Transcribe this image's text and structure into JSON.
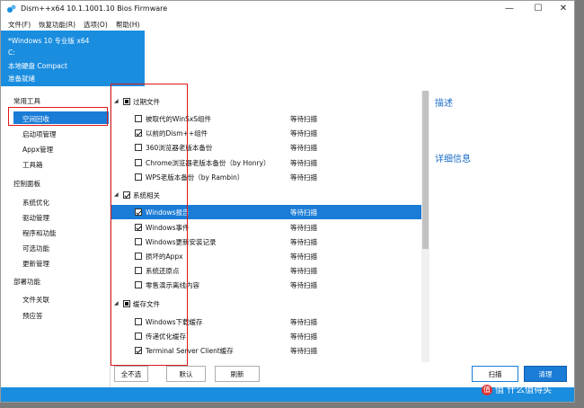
{
  "window": {
    "title": "Dism++x64 10.1.1001.10 Bios Firmware",
    "controls": {
      "minimize": "—",
      "maximize": "☐",
      "close": "✕"
    }
  },
  "menu": [
    "文件(F)",
    "恢复功能(R)",
    "选项(O)",
    "帮助(H)"
  ],
  "header": {
    "os": "*Windows 10 专业版 x64",
    "drive": "C:",
    "disk": "本地硬盘 Compact",
    "status": "准备就绪"
  },
  "sidebar": {
    "group_common": "常用工具",
    "item_cleanup": "空间回收",
    "item_startup": "启动项管理",
    "item_appx": "Appx管理",
    "item_toolbox": "工具箱",
    "group_control": "控制面板",
    "item_optimize": "系统优化",
    "item_drivers": "驱动管理",
    "item_programs": "程序和功能",
    "item_optional": "可选功能",
    "item_updates": "更新管理",
    "group_deploy": "部署功能",
    "item_assoc": "文件关联",
    "item_answer": "预应答"
  },
  "list": {
    "status_waiting": "等待扫描",
    "group_expired": "过期文件",
    "group_system": "系统相关",
    "group_cache": "缓存文件",
    "items": [
      "被取代的WinSxS组件",
      "以前的Dism++组件",
      "360浏览器老版本备份",
      "Chrome浏览器老版本备份（by Honry）",
      "WPS老版本备份（by Rambin）",
      "Windows报告",
      "Windows事件",
      "Windows更新安装记录",
      "损坏的Appx",
      "系统还原点",
      "零售演示离线内容",
      "Windows下载缓存",
      "传递优化缓存",
      "Terminal Server Client缓存"
    ]
  },
  "right": {
    "description": "描述",
    "details": "详细信息"
  },
  "buttons": {
    "deselect_all": "全不选",
    "default": "默认",
    "refresh": "刷新",
    "scan": "扫描",
    "clean": "清理"
  },
  "watermark": "值 什么值得买",
  "colors": {
    "accent": "#1a8ddf",
    "selection": "#1a7cd6",
    "highlight_box": "#e01818"
  }
}
